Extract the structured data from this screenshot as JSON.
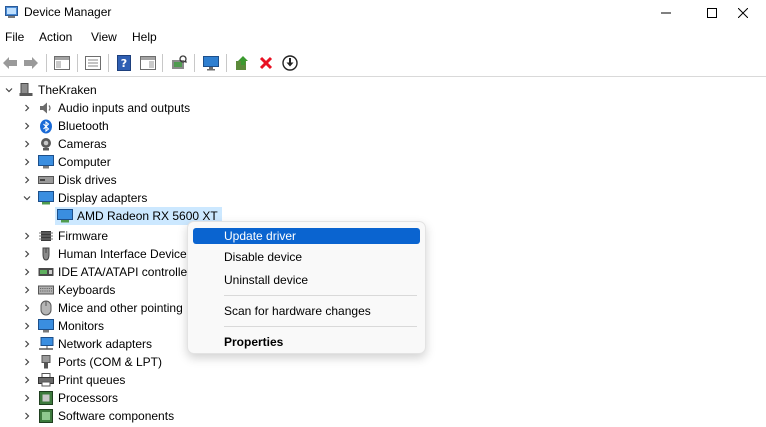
{
  "window": {
    "title": "Device Manager",
    "icon": "device-manager-icon",
    "controls": [
      "minimize-icon",
      "maximize-icon",
      "close-icon"
    ]
  },
  "menu": {
    "file": "File",
    "action": "Action",
    "view": "View",
    "help": "Help"
  },
  "toolbar": {
    "buttons": [
      "back-icon",
      "forward-icon",
      "properties-pane-icon",
      "show-hide-tree-icon",
      "help-icon",
      "view-icon",
      "scan-hardware-icon",
      "monitor-icon",
      "update-driver-icon",
      "uninstall-icon",
      "disable-device-icon"
    ]
  },
  "tree": {
    "root": "TheKraken",
    "categories": [
      {
        "label": "Audio inputs and outputs",
        "icon": "speaker-icon"
      },
      {
        "label": "Bluetooth",
        "icon": "bluetooth-icon"
      },
      {
        "label": "Cameras",
        "icon": "camera-icon"
      },
      {
        "label": "Computer",
        "icon": "computer-icon"
      },
      {
        "label": "Disk drives",
        "icon": "disk-drive-icon"
      },
      {
        "label": "Display adapters",
        "icon": "display-adapter-icon",
        "expanded": true
      },
      {
        "label": "Firmware",
        "icon": "firmware-icon"
      },
      {
        "label": "Human Interface Device",
        "icon": "hid-icon"
      },
      {
        "label": "IDE ATA/ATAPI controlle",
        "icon": "ide-controller-icon"
      },
      {
        "label": "Keyboards",
        "icon": "keyboard-icon"
      },
      {
        "label": "Mice and other pointing",
        "icon": "mouse-icon"
      },
      {
        "label": "Monitors",
        "icon": "monitor-icon"
      },
      {
        "label": "Network adapters",
        "icon": "network-adapter-icon"
      },
      {
        "label": "Ports (COM & LPT)",
        "icon": "port-icon"
      },
      {
        "label": "Print queues",
        "icon": "printer-icon"
      },
      {
        "label": "Processors",
        "icon": "processor-icon"
      },
      {
        "label": "Software components",
        "icon": "software-component-icon"
      }
    ],
    "selected_device": "AMD Radeon RX 5600 XT"
  },
  "context_menu": {
    "update_driver": "Update driver",
    "disable_device": "Disable device",
    "uninstall_device": "Uninstall device",
    "scan_hardware": "Scan for hardware changes",
    "properties": "Properties",
    "highlighted": "Update driver"
  },
  "colors": {
    "highlight": "#0a64d0",
    "selection": "#cce8ff",
    "uninstall_red": "#e81123"
  }
}
